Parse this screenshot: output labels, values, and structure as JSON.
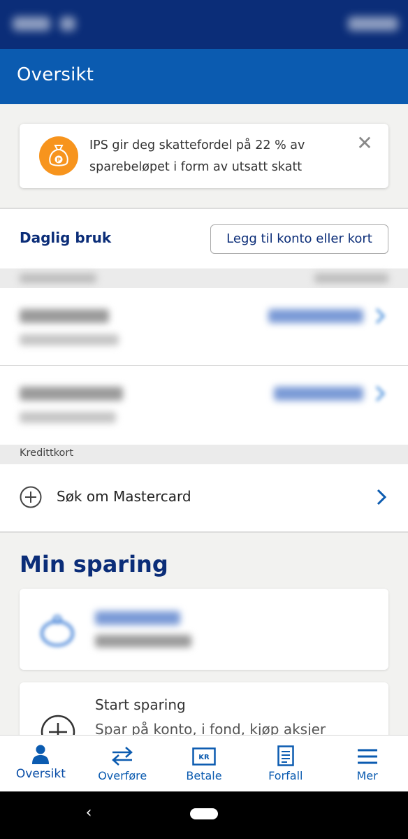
{
  "header": {
    "title": "Oversikt"
  },
  "tip": {
    "text": "IPS gir deg skattefordel på 22 % av sparebeløpet i form av utsatt skatt",
    "close_glyph": "✕",
    "icon": "money-bag-icon"
  },
  "daily": {
    "title": "Daglig bruk",
    "add_button": "Legg til konto eller kort"
  },
  "credit": {
    "section_label": "Kredittkort",
    "apply_label": "Søk om Mastercard"
  },
  "savings": {
    "title": "Min sparing",
    "start_title": "Start sparing",
    "start_subtitle": "Spar på konto, i fond, kjøp aksjer"
  },
  "nav": {
    "items": [
      {
        "label": "Oversikt",
        "icon": "person-icon",
        "active": true
      },
      {
        "label": "Overføre",
        "icon": "transfer-arrows-icon"
      },
      {
        "label": "Betale",
        "icon": "kr-card-icon"
      },
      {
        "label": "Forfall",
        "icon": "document-icon"
      },
      {
        "label": "Mer",
        "icon": "menu-icon"
      }
    ]
  },
  "system_nav": {
    "back_glyph": "‹"
  },
  "colors": {
    "brand_dark": "#0b2d78",
    "brand": "#0b5bb0",
    "accent_orange": "#f7941d"
  }
}
